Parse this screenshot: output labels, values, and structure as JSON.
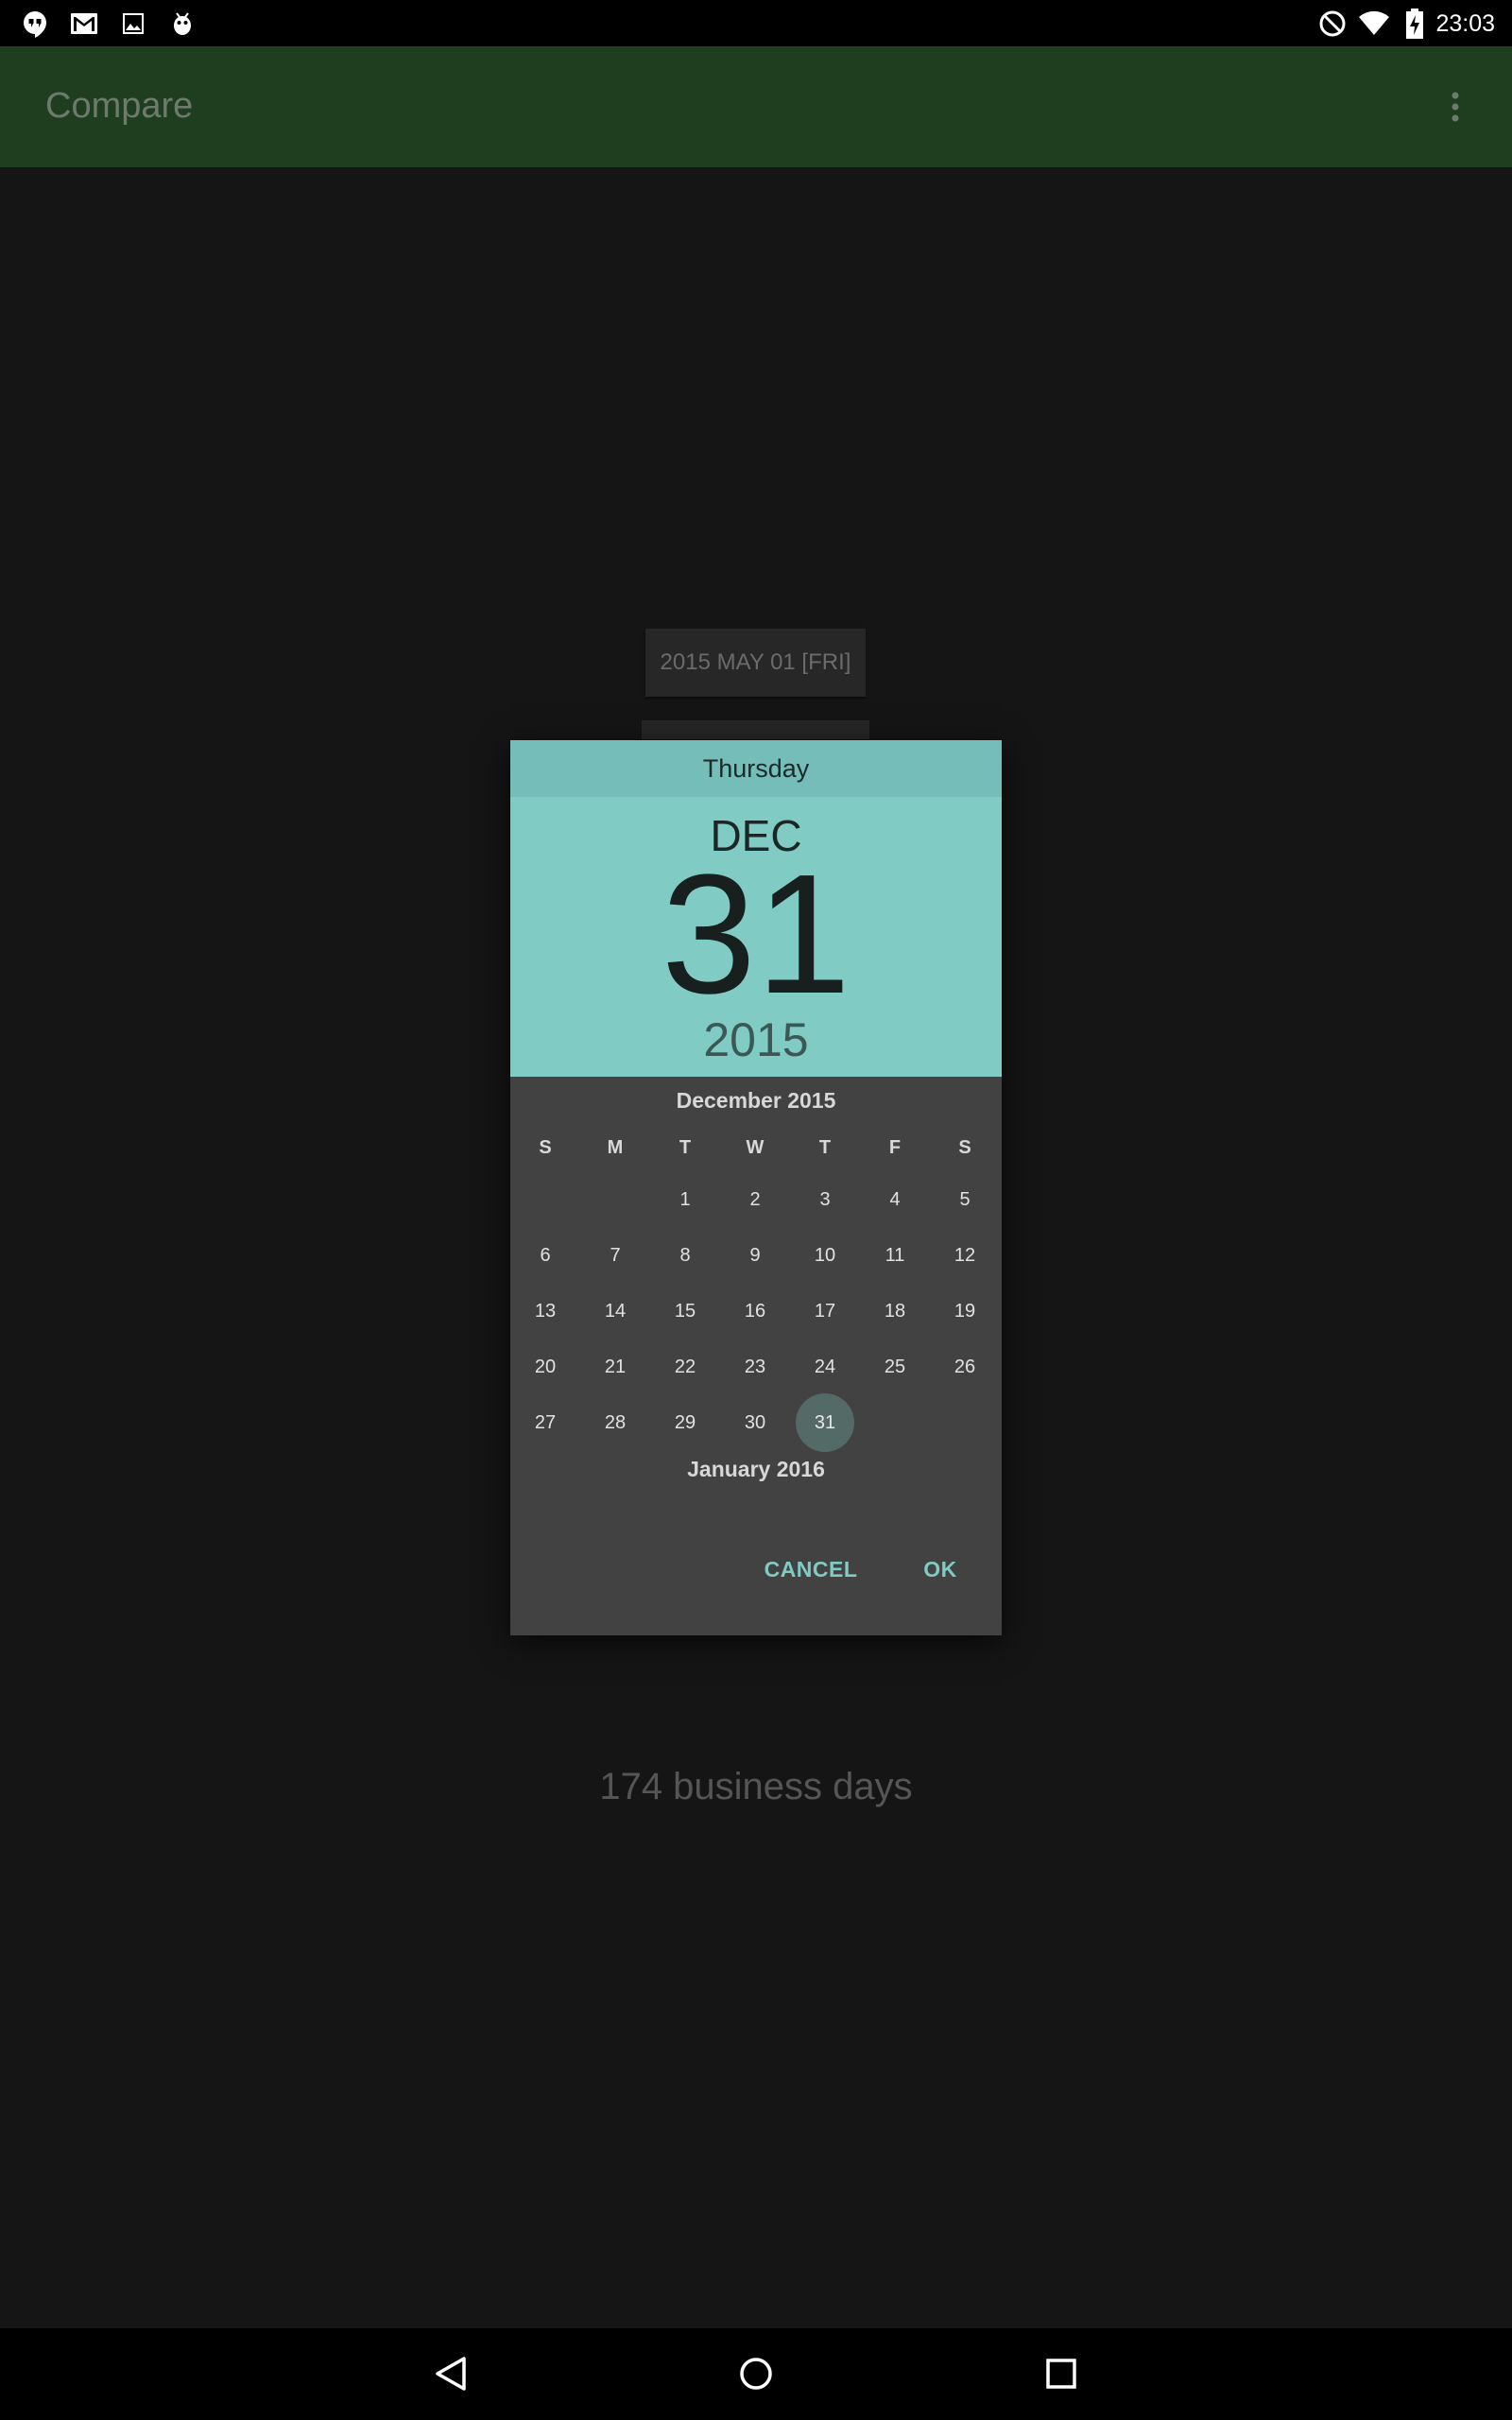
{
  "status_bar": {
    "time": "23:03",
    "left_icons": [
      "hangouts-icon",
      "gmail-icon",
      "gallery-icon",
      "android-debug-icon"
    ],
    "right_icons": [
      "do-not-disturb-icon",
      "wifi-icon",
      "battery-charging-icon"
    ]
  },
  "app_bar": {
    "title": "Compare",
    "menu_icon": "overflow-menu-icon"
  },
  "background": {
    "start_date": "2015 MAY 01 [FRI]",
    "result": "174 business days"
  },
  "dialog": {
    "day_of_week": "Thursday",
    "month": "DEC",
    "day": "31",
    "year": "2015",
    "calendar": {
      "month_label": "December 2015",
      "weekdays": [
        "S",
        "M",
        "T",
        "W",
        "T",
        "F",
        "S"
      ],
      "weeks": [
        [
          "",
          "",
          "1",
          "2",
          "3",
          "4",
          "5"
        ],
        [
          "6",
          "7",
          "8",
          "9",
          "10",
          "11",
          "12"
        ],
        [
          "13",
          "14",
          "15",
          "16",
          "17",
          "18",
          "19"
        ],
        [
          "20",
          "21",
          "22",
          "23",
          "24",
          "25",
          "26"
        ],
        [
          "27",
          "28",
          "29",
          "30",
          "31",
          "",
          ""
        ]
      ],
      "selected_day": "31",
      "next_month_label": "January 2016"
    },
    "buttons": {
      "cancel": "CANCEL",
      "ok": "OK"
    },
    "accent_color": "#80cbc4"
  },
  "nav_bar": {
    "icons": [
      "back-icon",
      "home-icon",
      "recents-icon"
    ]
  }
}
